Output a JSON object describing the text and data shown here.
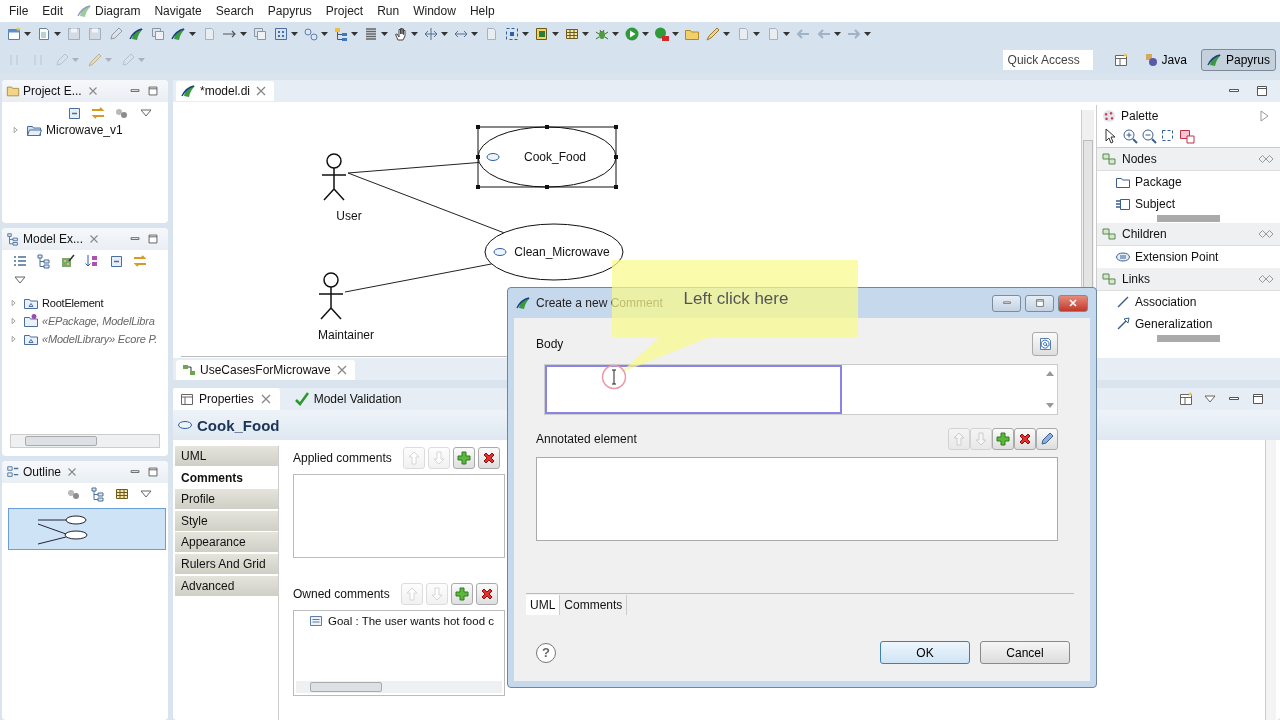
{
  "menu": [
    {
      "label": "File",
      "icon": false
    },
    {
      "label": "Edit",
      "icon": false
    },
    {
      "label": "Diagram",
      "icon": true
    },
    {
      "label": "Navigate",
      "icon": false
    },
    {
      "label": "Search",
      "icon": false
    },
    {
      "label": "Papyrus",
      "icon": false
    },
    {
      "label": "Project",
      "icon": false
    },
    {
      "label": "Run",
      "icon": false
    },
    {
      "label": "Window",
      "icon": false
    },
    {
      "label": "Help",
      "icon": false
    }
  ],
  "quick_access": {
    "placeholder": "Quick Access"
  },
  "perspectives": [
    {
      "label": "Java",
      "kind": "java",
      "selected": false
    },
    {
      "label": "Papyrus",
      "kind": "papyrus",
      "selected": true
    }
  ],
  "project_explorer": {
    "title": "Project E...",
    "items": [
      {
        "label": "Microwave_v1",
        "expanded": false
      }
    ]
  },
  "model_explorer": {
    "title": "Model Ex...",
    "items": [
      {
        "label": "RootElement",
        "kind": "plain",
        "expanded": false
      },
      {
        "label": "«EPackage, ModelLibra",
        "kind": "stereotyped",
        "expanded": false
      },
      {
        "label": "«ModelLibrary» Ecore P.",
        "kind": "stereotyped",
        "expanded": false
      }
    ]
  },
  "outline": {
    "title": "Outline"
  },
  "editor": {
    "tab": "*model.di",
    "diagram_tab": "UseCasesForMicrowave",
    "actors": [
      {
        "name": "User"
      },
      {
        "name": "Maintainer"
      }
    ],
    "use_cases": [
      {
        "name": "Cook_Food",
        "selected": true
      },
      {
        "name": "Clean_Microwave",
        "selected": false
      }
    ]
  },
  "palette": {
    "title": "Palette",
    "groups": [
      {
        "name": "Nodes",
        "items": [
          {
            "label": "Package",
            "kind": "package"
          },
          {
            "label": "Subject",
            "kind": "subject"
          }
        ]
      },
      {
        "name": "Children",
        "items": [
          {
            "label": "Extension Point",
            "kind": "extension"
          }
        ]
      },
      {
        "name": "Links",
        "items": [
          {
            "label": "Association",
            "kind": "association"
          },
          {
            "label": "Generalization",
            "kind": "generalization"
          }
        ]
      }
    ]
  },
  "properties": {
    "tabs": [
      {
        "label": "Properties",
        "selected": true
      },
      {
        "label": "Model Validation",
        "selected": false
      }
    ],
    "element": "Cook_Food",
    "sections": [
      {
        "label": "UML",
        "selected": false
      },
      {
        "label": "Comments",
        "selected": true
      },
      {
        "label": "Profile",
        "selected": false
      },
      {
        "label": "Style",
        "selected": false
      },
      {
        "label": "Appearance",
        "selected": false
      },
      {
        "label": "Rulers And Grid",
        "selected": false
      },
      {
        "label": "Advanced",
        "selected": false
      }
    ],
    "applied": {
      "label": "Applied comments",
      "buttons": [
        {
          "kind": "up",
          "disabled": true
        },
        {
          "kind": "down",
          "disabled": true
        },
        {
          "kind": "add",
          "disabled": false
        },
        {
          "kind": "delete",
          "disabled": false
        }
      ]
    },
    "owned": {
      "label": "Owned comments",
      "buttons": [
        {
          "kind": "up",
          "disabled": true
        },
        {
          "kind": "down",
          "disabled": true
        },
        {
          "kind": "add",
          "disabled": false
        },
        {
          "kind": "delete",
          "disabled": false
        }
      ],
      "items": [
        "Goal : The user wants hot food c"
      ]
    }
  },
  "dialog": {
    "title": "Create a new Comment",
    "body_label": "Body",
    "annotated": {
      "label": "Annotated element",
      "buttons": [
        {
          "kind": "up",
          "disabled": true
        },
        {
          "kind": "down",
          "disabled": true
        },
        {
          "kind": "add",
          "disabled": false
        },
        {
          "kind": "delete",
          "disabled": false
        },
        {
          "kind": "edit",
          "disabled": false
        }
      ]
    },
    "tabs": [
      {
        "label": "UML",
        "selected": true
      },
      {
        "label": "Comments",
        "selected": false
      }
    ],
    "help": "?",
    "buttons": [
      {
        "label": "OK",
        "kind": "default"
      },
      {
        "label": "Cancel",
        "kind": "normal"
      }
    ]
  },
  "callout": "Left click here"
}
